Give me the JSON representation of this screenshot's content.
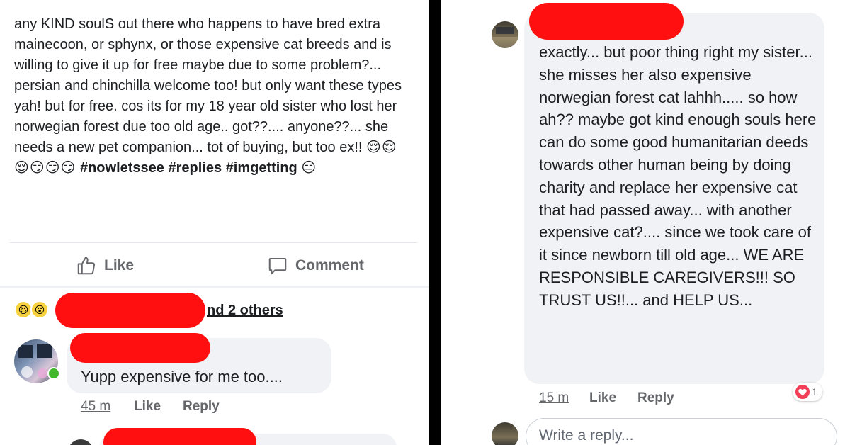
{
  "left": {
    "post": {
      "text": "any KIND soulS out there who happens to have bred extra mainecoon, or sphynx, or those expensive cat breeds and is willing to give it up for free maybe due to some problem?... persian and chinchilla welcome too! but only want these types yah! but for free. cos its for my 18 year old sister who lost  her norwegian forest due too old age.. got??.... anyone??... she needs a new pet companion... tot of buying, but too ex!!",
      "emojis": "😌😌😌😏😏😏",
      "hashtags": "#nowletssee #replies #imgetting",
      "end_emoji": "😑"
    },
    "actions": {
      "like_label": "Like",
      "comment_label": "Comment"
    },
    "reactions": {
      "emoji_1": "😆",
      "emoji_2": "😮",
      "others_text": "nd 2 others"
    },
    "comment": {
      "text": "Yupp expensive for me too....",
      "time": "45 m",
      "like_label": "Like",
      "reply_label": "Reply"
    }
  },
  "right": {
    "comment": {
      "text": "exactly... but poor thing right my sister... she misses her also expensive norwegian forest cat lahhh..... so how ah?? maybe got kind enough souls here can do some good humanitarian deeds towards other human being by doing charity and replace her expensive cat that had passed away... with another expensive cat?.... since we took care of it since newborn till old age... WE ARE RESPONSIBLE CAREGIVERS!!! SO TRUST US!!... and HELP US...",
      "time": "15 m",
      "like_label": "Like",
      "reply_label": "Reply",
      "reaction_count": "1"
    },
    "reply_input": {
      "placeholder": "Write a reply..."
    }
  },
  "colors": {
    "redaction": "#ff0f0f",
    "text": "#1c1e21",
    "meta": "#65676b",
    "bubble": "#f0f2f5",
    "heart": "#f33e58",
    "online": "#42b72a"
  }
}
